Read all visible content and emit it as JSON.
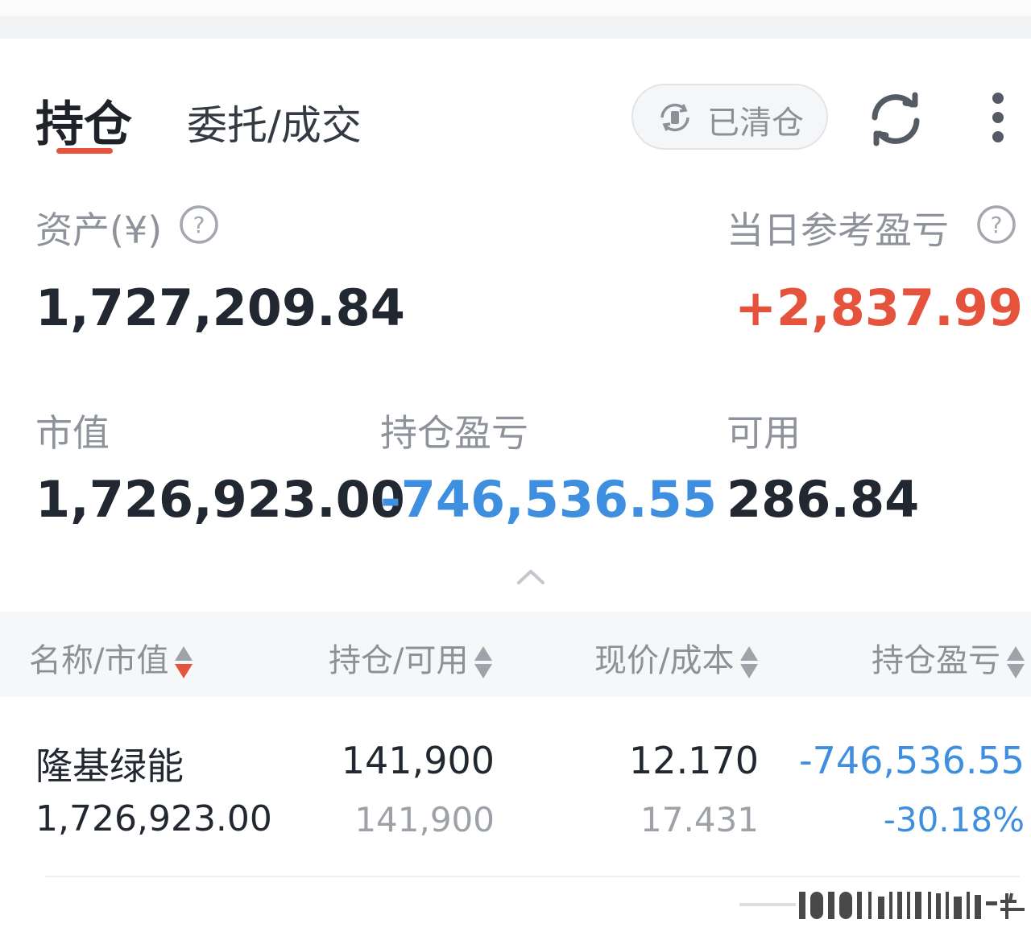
{
  "header": {
    "tab_positions": "持仓",
    "tab_orders": "委托/成交",
    "cleared_button": "已清仓"
  },
  "summary": {
    "assets_label": "资产(¥)",
    "assets_value": "1,727,209.84",
    "daily_pnl_label": "当日参考盈亏",
    "daily_pnl_value": "+2,837.99",
    "market_value_label": "市值",
    "market_value": "1,726,923.00",
    "position_pnl_label": "持仓盈亏",
    "position_pnl_value": "-746,536.55",
    "available_label": "可用",
    "available_value": "286.84"
  },
  "table": {
    "columns": [
      "名称/市值",
      "持仓/可用",
      "现价/成本",
      "持仓盈亏"
    ],
    "rows": [
      {
        "name": "隆基绿能",
        "market_value": "1,726,923.00",
        "quantity": "141,900",
        "available": "141,900",
        "price": "12.170",
        "cost": "17.431",
        "pnl": "-746,536.55",
        "pnl_pct": "-30.18%"
      }
    ]
  },
  "colors": {
    "accent_red": "#e5533d",
    "loss_blue": "#3f8fe0"
  },
  "icons": [
    "cleared-icon",
    "refresh-icon",
    "more-icon",
    "help-icon",
    "chevron-up-icon",
    "sort-icon"
  ]
}
